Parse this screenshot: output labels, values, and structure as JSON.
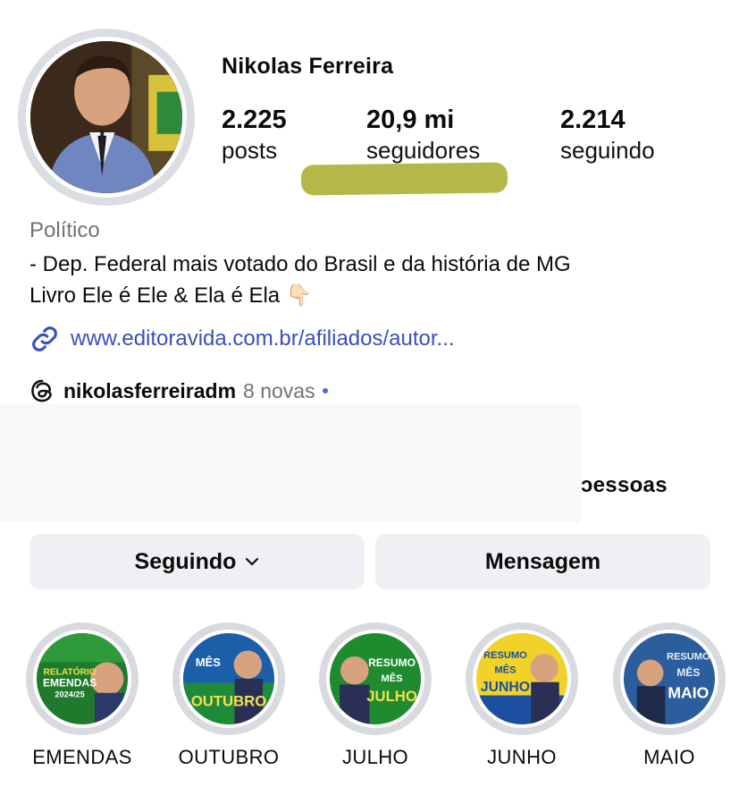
{
  "profile": {
    "name": "Nikolas Ferreira",
    "stats": [
      {
        "value": "2.225",
        "label": "posts"
      },
      {
        "value": "20,9 mi",
        "label": "seguidores"
      },
      {
        "value": "2.214",
        "label": "seguindo"
      }
    ],
    "category": "Político",
    "bio_line1": "- Dep. Federal mais votado do Brasil e da história de MG",
    "bio_line2": "Livro Ele é Ele & Ela é Ela 👇🏻",
    "link": "www.editoravida.com.br/afiliados/autor...",
    "threads_handle": "nikolasferreiradm",
    "threads_new": "8 novas",
    "followed_by_fragment": "ɔessoas"
  },
  "actions": {
    "following_label": "Seguindo",
    "message_label": "Mensagem"
  },
  "highlights": [
    {
      "label": "EMENDAS",
      "text": "RELATÓRIO EMENDAS 2024/25"
    },
    {
      "label": "OUTUBRO",
      "text": "OUTUBRO"
    },
    {
      "label": "JULHO",
      "text": "JULHO"
    },
    {
      "label": "JUNHO",
      "text": "JUNHO"
    },
    {
      "label": "MAIO",
      "text": "MAIO"
    }
  ],
  "colors": {
    "link": "#3a4fbf",
    "muted": "#737373",
    "button_bg": "#eff0f4",
    "highlight_marker": "#aeb238",
    "unread_dot": "#4a68e8"
  }
}
